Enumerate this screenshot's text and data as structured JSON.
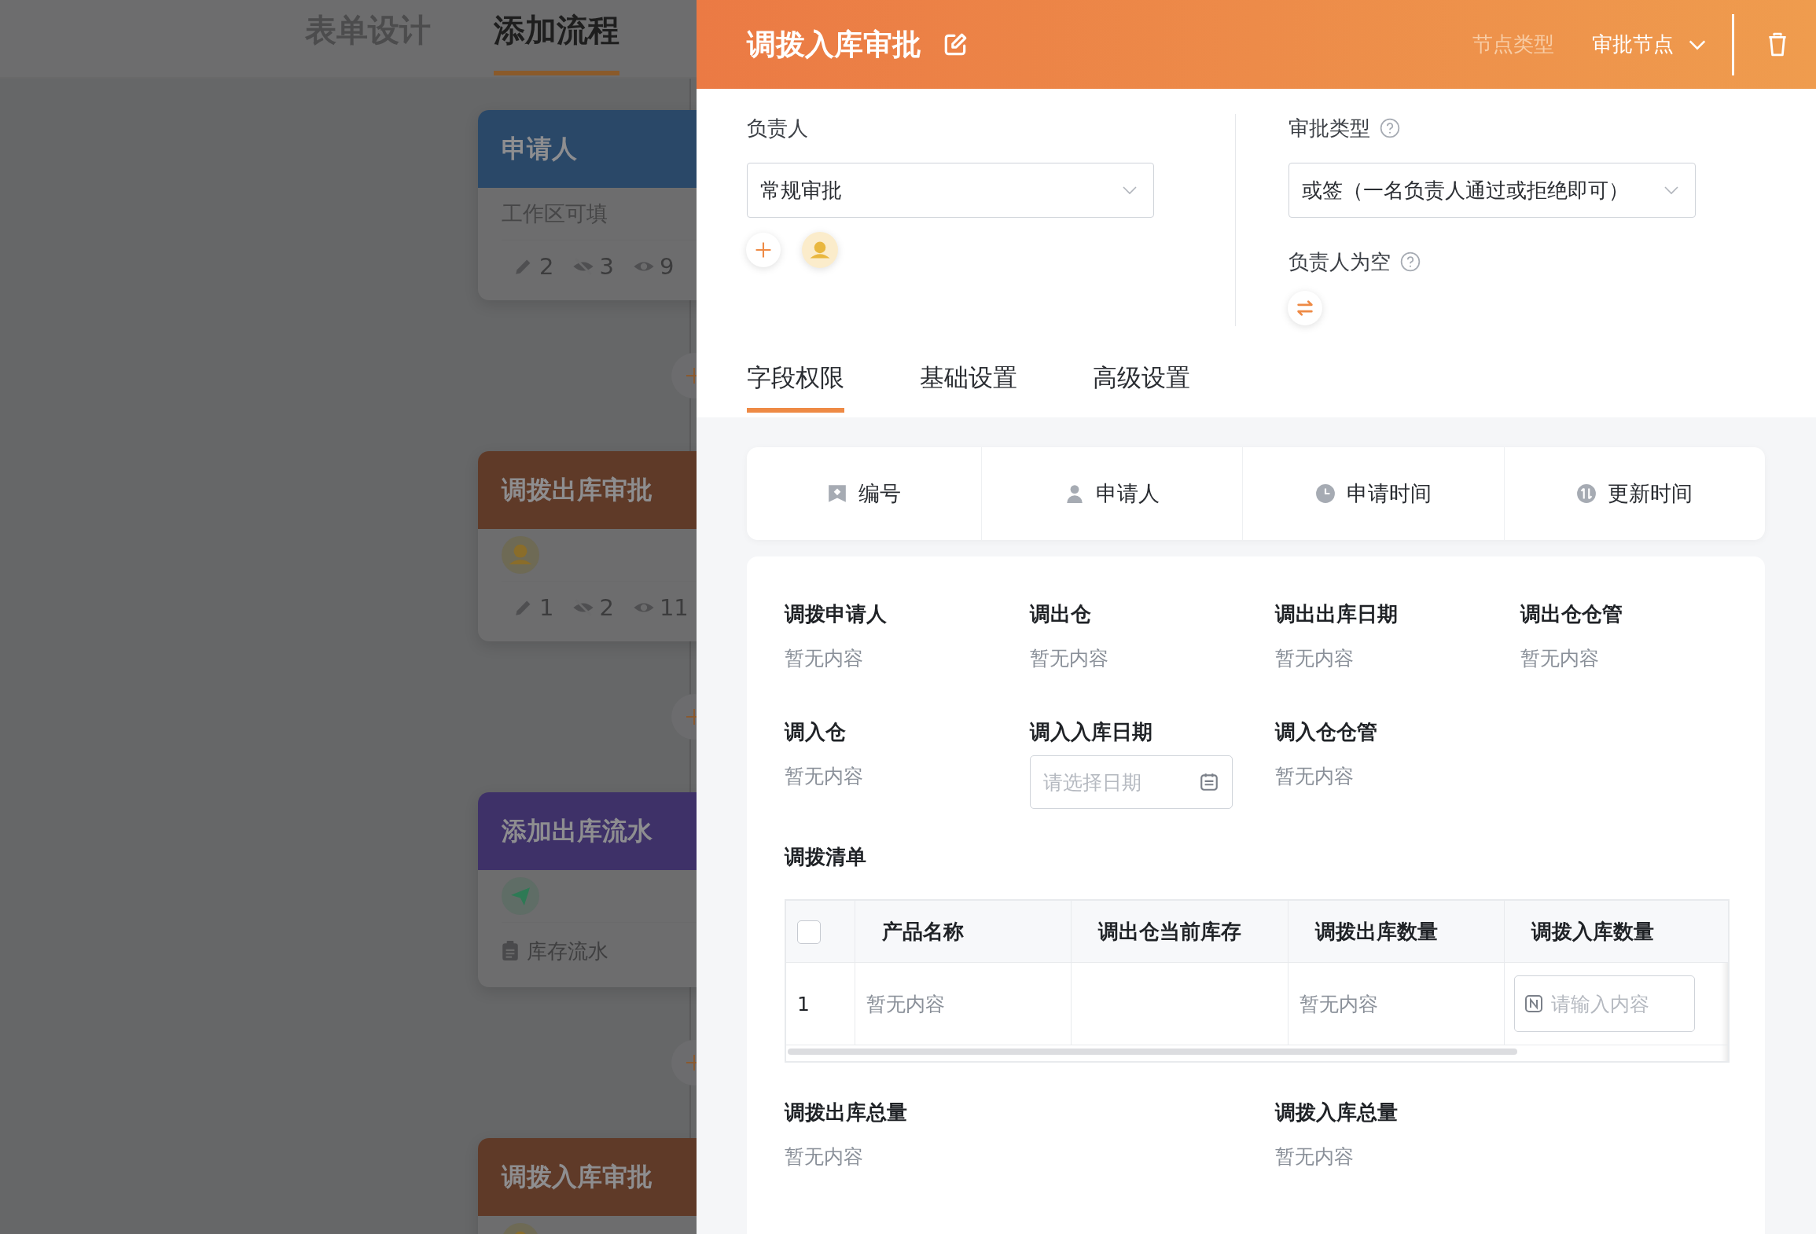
{
  "background": {
    "tabs": [
      {
        "label": "表单设计",
        "selected": false
      },
      {
        "label": "添加流程",
        "selected": true
      }
    ],
    "nodes": [
      {
        "title": "申请人",
        "color": "#2a4868",
        "kind": "text",
        "text": "工作区可填",
        "stats": [
          {
            "kind": "edit",
            "count": "2"
          },
          {
            "kind": "hidden",
            "count": "3"
          },
          {
            "kind": "view",
            "count": "9"
          }
        ]
      },
      {
        "title": "调拨出库审批",
        "color": "#5f3a28",
        "kind": "avatar",
        "stats": [
          {
            "kind": "edit",
            "count": "1"
          },
          {
            "kind": "hidden",
            "count": "2"
          },
          {
            "kind": "view",
            "count": "11"
          }
        ]
      },
      {
        "title": "添加出库流水",
        "color": "#3e3168",
        "kind": "action",
        "text": "库存流水"
      },
      {
        "title": "调拨入库审批",
        "color": "#5f3a28",
        "kind": "avatar"
      }
    ]
  },
  "panel": {
    "header": {
      "title": "调拨入库审批",
      "type_label": "节点类型",
      "type_value": "审批节点"
    },
    "assignee": {
      "label": "负责人",
      "select": "常规审批"
    },
    "approval_type": {
      "label": "审批类型",
      "select": "或签（一名负责人通过或拒绝即可）"
    },
    "empty_assignee": {
      "label": "负责人为空"
    },
    "tabs": [
      {
        "label": "字段权限",
        "selected": true
      },
      {
        "label": "基础设置",
        "selected": false
      },
      {
        "label": "高级设置",
        "selected": false
      }
    ],
    "system_fields": [
      {
        "kind": "id",
        "label": "编号"
      },
      {
        "kind": "person",
        "label": "申请人"
      },
      {
        "kind": "clock",
        "label": "申请时间"
      },
      {
        "kind": "update",
        "label": "更新时间"
      }
    ],
    "fields": [
      {
        "label": "调拨申请人",
        "kind": "text",
        "value": "暂无内容"
      },
      {
        "label": "调出仓",
        "kind": "text",
        "value": "暂无内容"
      },
      {
        "label": "调出出库日期",
        "kind": "text",
        "value": "暂无内容"
      },
      {
        "label": "调出仓仓管",
        "kind": "text",
        "value": "暂无内容"
      },
      {
        "label": "调入仓",
        "kind": "text",
        "value": "暂无内容"
      },
      {
        "label": "调入入库日期",
        "kind": "date",
        "placeholder": "请选择日期"
      },
      {
        "label": "调入仓仓管",
        "kind": "text",
        "value": "暂无内容"
      }
    ],
    "list": {
      "title": "调拨清单",
      "select_all": {
        "checked": false
      },
      "columns": [
        "产品名称",
        "调出仓当前库存",
        "调拨出库数量",
        "调拨入库数量"
      ],
      "rows": [
        {
          "index": "1",
          "cells": [
            {
              "kind": "text",
              "value": "暂无内容"
            },
            {
              "kind": "empty"
            },
            {
              "kind": "text",
              "value": "暂无内容"
            },
            {
              "kind": "input",
              "placeholder": "请输入内容"
            }
          ]
        }
      ]
    },
    "totals": [
      {
        "label": "调拨出库总量",
        "value": "暂无内容"
      },
      {
        "label": "调拨入库总量",
        "value": "暂无内容"
      }
    ]
  }
}
